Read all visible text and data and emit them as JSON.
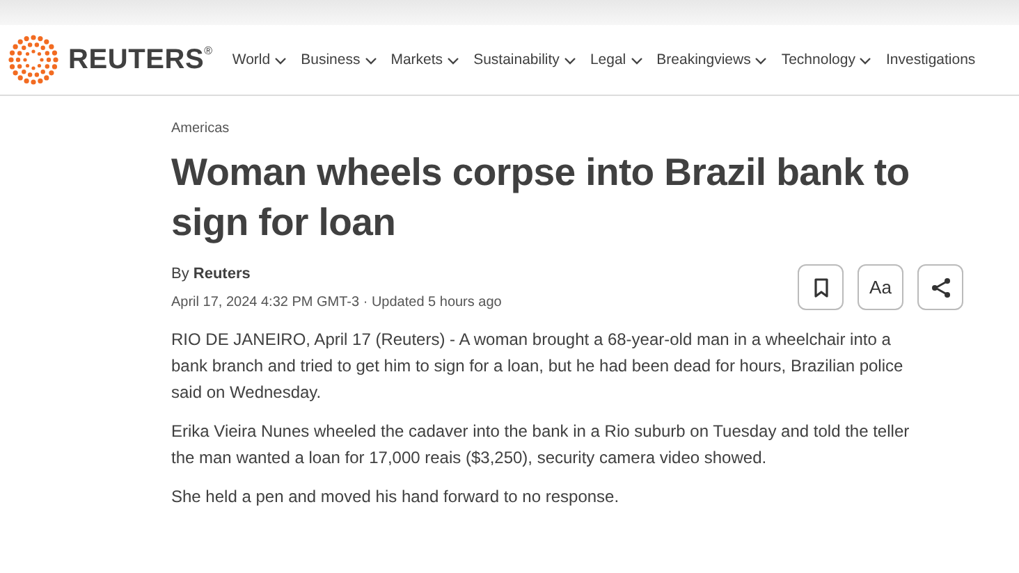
{
  "header": {
    "logo_text": "REUTERS$^{®}$",
    "nav": [
      {
        "label": "World",
        "has_menu": true
      },
      {
        "label": "Business",
        "has_menu": true
      },
      {
        "label": "Markets",
        "has_menu": true
      },
      {
        "label": "Sustainability",
        "has_menu": true
      },
      {
        "label": "Legal",
        "has_menu": true
      },
      {
        "label": "Breakingviews",
        "has_menu": true
      },
      {
        "label": "Technology",
        "has_menu": true
      },
      {
        "label": "Investigations",
        "has_menu": false
      }
    ]
  },
  "article": {
    "section": "Americas",
    "headline": "Woman wheels corpse into Brazil bank to sign for loan",
    "byline": "By **Reuters**",
    "dateline": "April 17, 2024 4:32 PM GMT-3 · Updated 5 hours ago",
    "tools": [
      {
        "kind": "bookmark"
      },
      {
        "kind": "text",
        "label": "Aa"
      },
      {
        "kind": "share"
      }
    ],
    "paragraphs": [
      "RIO DE JANEIRO, April 17 (Reuters) - A woman brought a 68-year-old man in a wheelchair into a bank branch and tried to get him to sign for a loan, but he had been dead for hours, Brazilian police said on Wednesday.",
      "Erika Vieira Nunes wheeled the cadaver into the bank in a Rio suburb on Tuesday and told the teller the man wanted a loan for 17,000 reais ($3,250), security camera video showed.",
      "She held a pen and moved his hand forward to no response."
    ]
  }
}
